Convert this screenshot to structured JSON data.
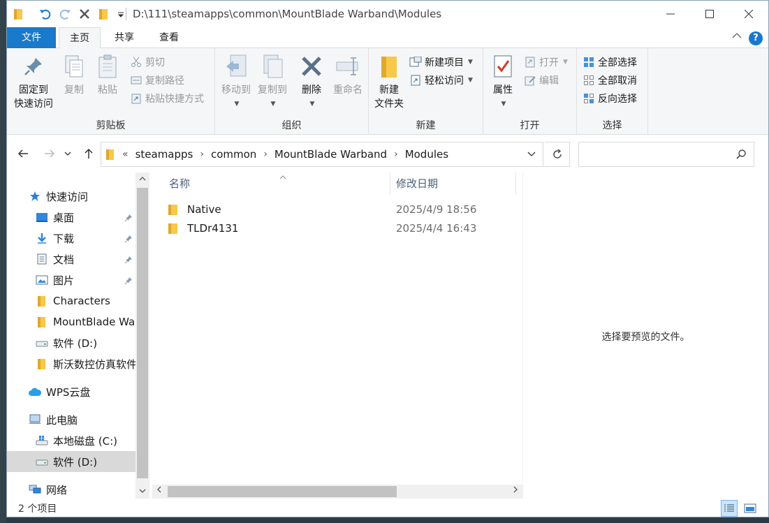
{
  "titlebar": {
    "path": "D:\\111\\steamapps\\common\\MountBlade Warband\\Modules",
    "icons": [
      "folder-icon",
      "undo-icon",
      "redo-icon",
      "delete-icon",
      "folder-icon",
      "dropdown-icon"
    ]
  },
  "tabs": {
    "file": "文件",
    "home": "主页",
    "share": "共享",
    "view": "查看"
  },
  "help_label": "?",
  "ribbon": {
    "clipboard": {
      "label": "剪贴板",
      "pin_quick": "固定到\n快速访问",
      "pin_line1": "固定到",
      "pin_line2": "快速访问",
      "copy": "复制",
      "paste": "粘贴",
      "cut": "剪切",
      "copy_path": "复制路径",
      "paste_shortcut": "粘贴快捷方式"
    },
    "organize": {
      "label": "组织",
      "move_to": "移动到",
      "copy_to": "复制到",
      "delete": "删除",
      "rename": "重命名"
    },
    "new": {
      "label": "新建",
      "new_folder_line1": "新建",
      "new_folder_line2": "文件夹",
      "new_item": "新建项目",
      "easy_access": "轻松访问"
    },
    "open": {
      "label": "打开",
      "properties": "属性",
      "open": "打开",
      "edit": "编辑"
    },
    "select": {
      "label": "选择",
      "select_all": "全部选择",
      "select_none": "全部取消",
      "invert": "反向选择"
    }
  },
  "address": {
    "overflow": "«",
    "crumbs": [
      "steamapps",
      "common",
      "MountBlade Warband",
      "Modules"
    ]
  },
  "navpane": {
    "quick_access": "快速访问",
    "items": [
      {
        "label": "桌面",
        "pinned": true
      },
      {
        "label": "下载",
        "pinned": true
      },
      {
        "label": "文档",
        "pinned": true
      },
      {
        "label": "图片",
        "pinned": true
      },
      {
        "label": "Characters",
        "pinned": false
      },
      {
        "label": "MountBlade Warband",
        "pinned": false
      },
      {
        "label": "软件 (D:)",
        "pinned": false
      },
      {
        "label": "斯沃数控仿真软件",
        "pinned": false
      }
    ],
    "wps": "WPS云盘",
    "this_pc": "此电脑",
    "local_c": "本地磁盘 (C:)",
    "soft_d": "软件 (D:)",
    "network": "网络"
  },
  "filelist": {
    "col_name": "名称",
    "col_date": "修改日期",
    "rows": [
      {
        "name": "Native",
        "date": "2025/4/9 18:56"
      },
      {
        "name": "TLDr4131",
        "date": "2025/4/4 16:43"
      }
    ]
  },
  "preview_text": "选择要预览的文件。",
  "status": {
    "count": "2 个项目"
  },
  "colors": {
    "accent": "#1979ca",
    "folder": "#f7c84a",
    "selected_nav": "#d9d9d9"
  }
}
